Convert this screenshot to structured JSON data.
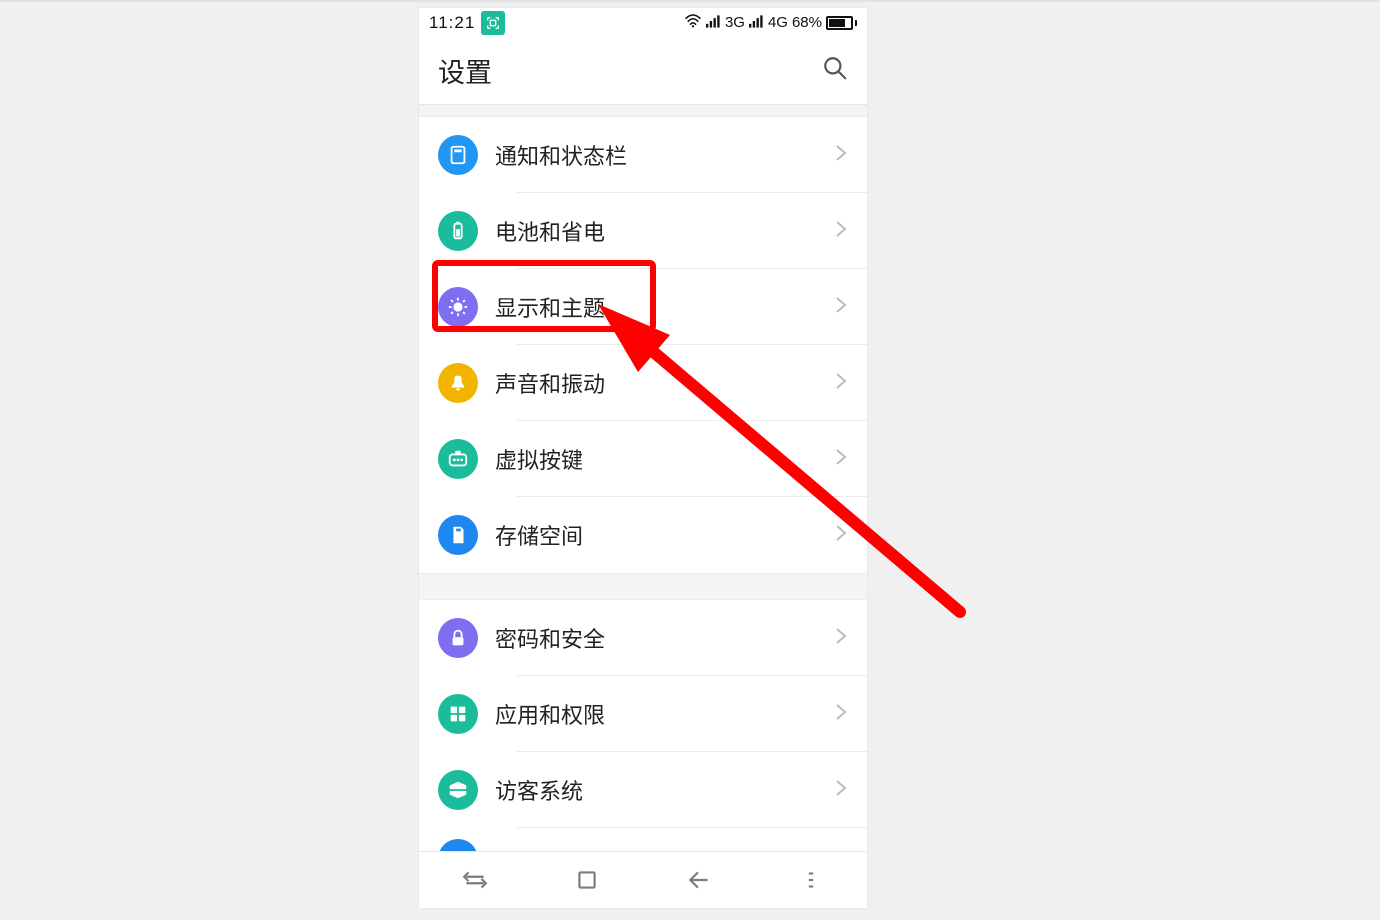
{
  "status": {
    "time": "11:21",
    "signal1_label": "3G",
    "signal2_label": "4G",
    "battery_pct": "68%"
  },
  "header": {
    "title": "设置"
  },
  "sections": [
    {
      "items": [
        {
          "label": "通知和状态栏",
          "icon": "notification-statusbar-icon",
          "color": "bg-blue"
        },
        {
          "label": "电池和省电",
          "icon": "battery-saving-icon",
          "color": "bg-green"
        },
        {
          "label": "显示和主题",
          "icon": "display-theme-icon",
          "color": "bg-purple",
          "highlighted": true
        },
        {
          "label": "声音和振动",
          "icon": "sound-vibration-icon",
          "color": "bg-yellow"
        },
        {
          "label": "虚拟按键",
          "icon": "virtual-keys-icon",
          "color": "bg-teal"
        },
        {
          "label": "存储空间",
          "icon": "storage-icon",
          "color": "bg-blue2"
        }
      ]
    },
    {
      "items": [
        {
          "label": "密码和安全",
          "icon": "password-security-icon",
          "color": "bg-purple"
        },
        {
          "label": "应用和权限",
          "icon": "apps-permissions-icon",
          "color": "bg-green2"
        },
        {
          "label": "访客系统",
          "icon": "guest-mode-icon",
          "color": "bg-teal2"
        }
      ]
    }
  ],
  "annotation": {
    "highlight_target": "显示和主题"
  }
}
